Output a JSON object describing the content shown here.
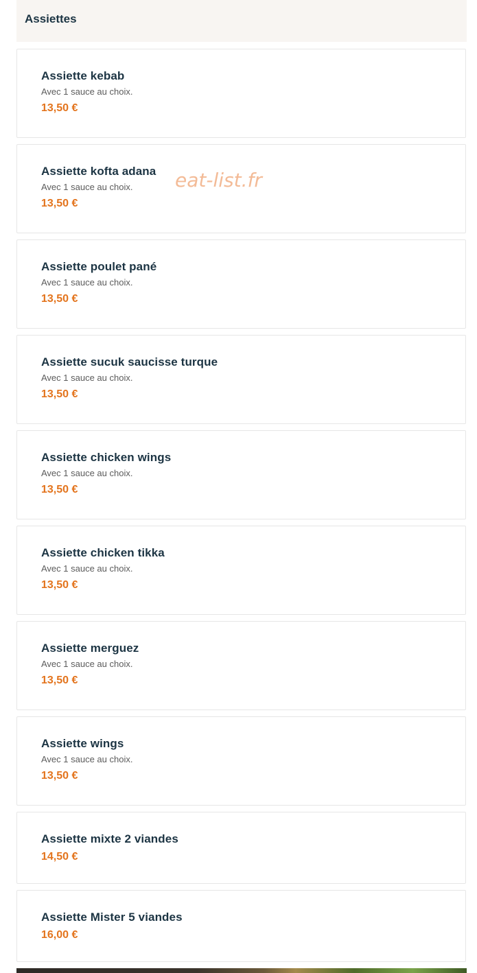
{
  "category": {
    "title": "Assiettes"
  },
  "watermark": "eat-list.fr",
  "items": [
    {
      "name": "Assiette kebab",
      "description": "Avec 1 sauce au choix.",
      "price": "13,50 €"
    },
    {
      "name": "Assiette kofta adana",
      "description": "Avec 1 sauce au choix.",
      "price": "13,50 €"
    },
    {
      "name": "Assiette poulet pané",
      "description": "Avec 1 sauce au choix.",
      "price": "13,50 €"
    },
    {
      "name": "Assiette sucuk saucisse turque",
      "description": "Avec 1 sauce au choix.",
      "price": "13,50 €"
    },
    {
      "name": "Assiette chicken wings",
      "description": "Avec 1 sauce au choix.",
      "price": "13,50 €"
    },
    {
      "name": "Assiette chicken tikka",
      "description": "Avec 1 sauce au choix.",
      "price": "13,50 €"
    },
    {
      "name": "Assiette merguez",
      "description": "Avec 1 sauce au choix.",
      "price": "13,50 €"
    },
    {
      "name": "Assiette wings",
      "description": "Avec 1 sauce au choix.",
      "price": "13,50 €"
    },
    {
      "name": "Assiette mixte 2 viandes",
      "price": "14,50 €"
    },
    {
      "name": "Assiette Mister 5 viandes",
      "price": "16,00 €"
    }
  ]
}
